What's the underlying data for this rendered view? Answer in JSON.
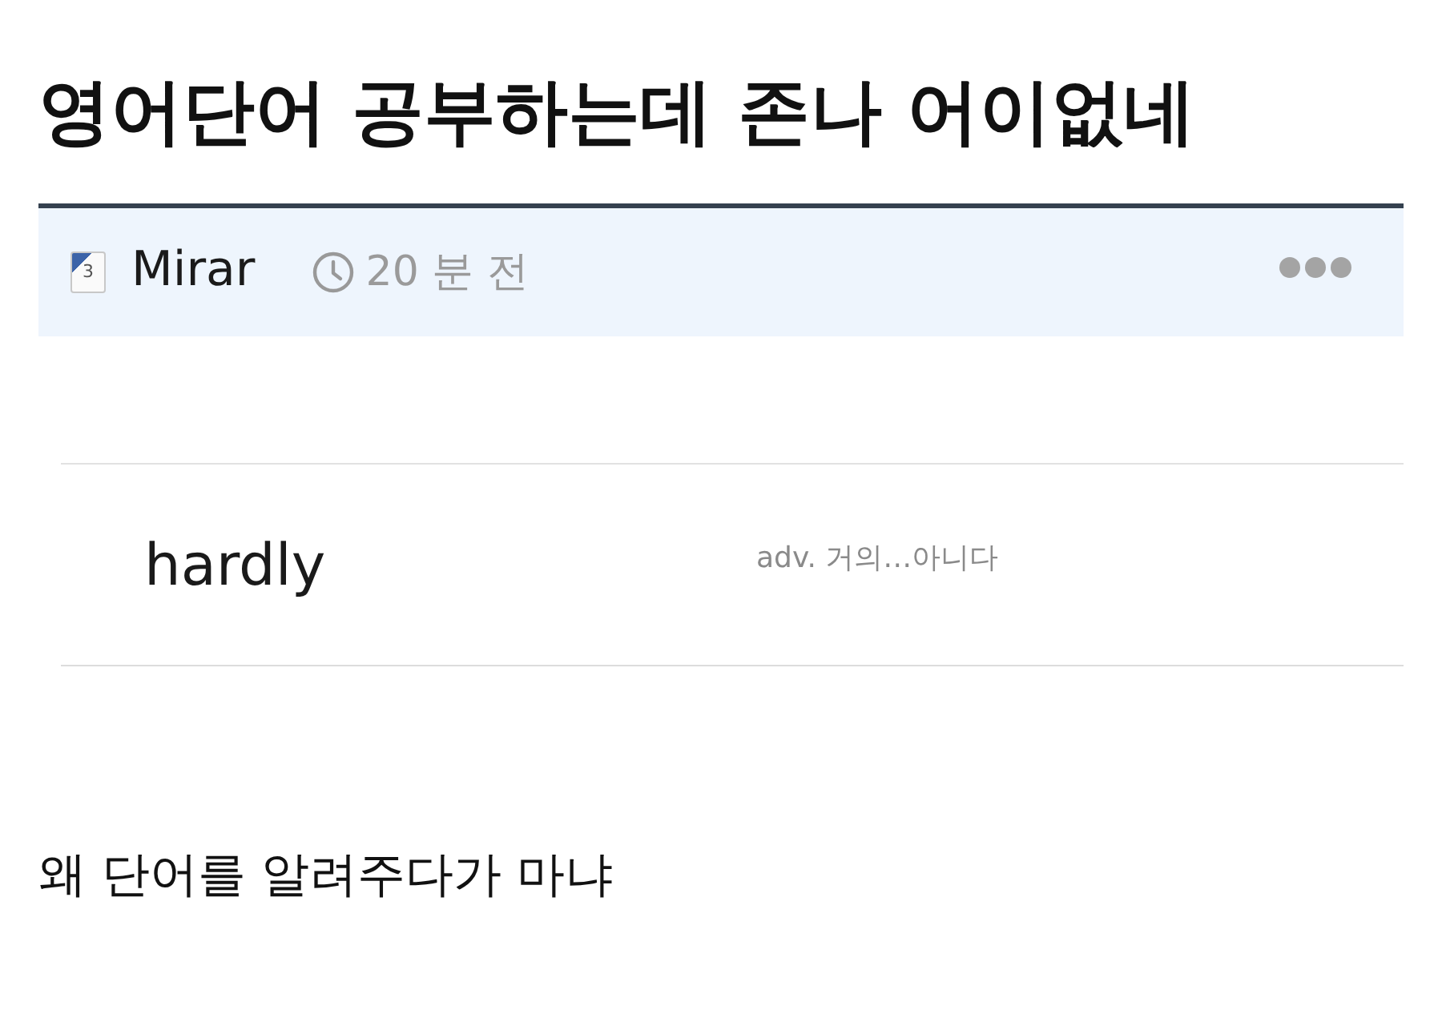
{
  "post": {
    "title": "영어단어 공부하는데 존나 어이없네"
  },
  "meta": {
    "badge": "3",
    "author": "Mirar",
    "time": "20 분 전"
  },
  "image": {
    "word": "hardly",
    "definition": "adv. 거의…아니다"
  },
  "body": "왜 단어를 알려주다가 마냐"
}
